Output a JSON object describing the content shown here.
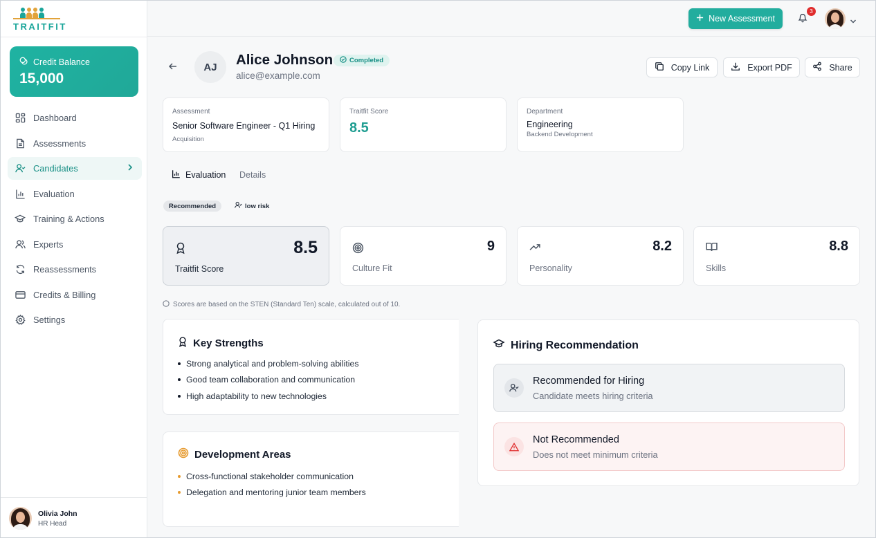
{
  "brand": {
    "logo_text": "TRAITFIT"
  },
  "credit": {
    "label": "Credit Balance",
    "value": "15,000"
  },
  "nav": [
    {
      "label": "Dashboard",
      "icon": "dashboard-icon"
    },
    {
      "label": "Assessments",
      "icon": "document-icon"
    },
    {
      "label": "Candidates",
      "icon": "user-check-icon",
      "active": true
    },
    {
      "label": "Evaluation",
      "icon": "bar-chart-icon"
    },
    {
      "label": "Training & Actions",
      "icon": "graduation-cap-icon"
    },
    {
      "label": "Experts",
      "icon": "users-icon"
    },
    {
      "label": "Reassessments",
      "icon": "refresh-icon"
    },
    {
      "label": "Credits & Billing",
      "icon": "credit-card-icon"
    },
    {
      "label": "Settings",
      "icon": "gear-icon"
    }
  ],
  "user": {
    "name": "Olivia John",
    "role": "HR Head"
  },
  "topbar": {
    "new_assessment": "New Assessment",
    "notification_count": "3"
  },
  "candidate": {
    "initials": "AJ",
    "name": "Alice Johnson",
    "status": "Completed",
    "email": "alice@example.com"
  },
  "actions": {
    "copy_link": "Copy Link",
    "export_pdf": "Export PDF",
    "share": "Share"
  },
  "info": {
    "assessment": {
      "label": "Assessment",
      "value": "Senior Software Engineer - Q1 Hiring",
      "sub": "Acquisition"
    },
    "score": {
      "label": "Traitfit Score",
      "value": "8.5"
    },
    "department": {
      "label": "Department",
      "value": "Engineering",
      "sub": "Backend Development"
    }
  },
  "tabs": {
    "evaluation": "Evaluation",
    "details": "Details"
  },
  "pills": {
    "recommended": "Recommended",
    "risk": "low risk"
  },
  "scores": [
    {
      "label": "Traitfit Score",
      "value": "8.5",
      "icon": "award-icon"
    },
    {
      "label": "Culture Fit",
      "value": "9",
      "icon": "target-icon"
    },
    {
      "label": "Personality",
      "value": "8.2",
      "icon": "trending-up-icon"
    },
    {
      "label": "Skills",
      "value": "8.8",
      "icon": "book-icon"
    }
  ],
  "note": "Scores are based on the STEN (Standard Ten) scale, calculated out of 10.",
  "strengths": {
    "title": "Key Strengths",
    "items": [
      "Strong analytical and problem-solving abilities",
      "Good team collaboration and communication",
      "High adaptability to new technologies"
    ]
  },
  "development": {
    "title": "Development Areas",
    "items": [
      "Cross-functional stakeholder communication",
      "Delegation and mentoring junior team members"
    ]
  },
  "hiring": {
    "title": "Hiring Recommendation",
    "recommended": {
      "title": "Recommended for Hiring",
      "sub": "Candidate meets hiring criteria"
    },
    "not_recommended": {
      "title": "Not Recommended",
      "sub": "Does not meet minimum criteria"
    }
  },
  "colors": {
    "accent": "#22ad9e",
    "accent_dark": "#178f85",
    "danger": "#e02d2d",
    "amber": "#e69a2e"
  }
}
